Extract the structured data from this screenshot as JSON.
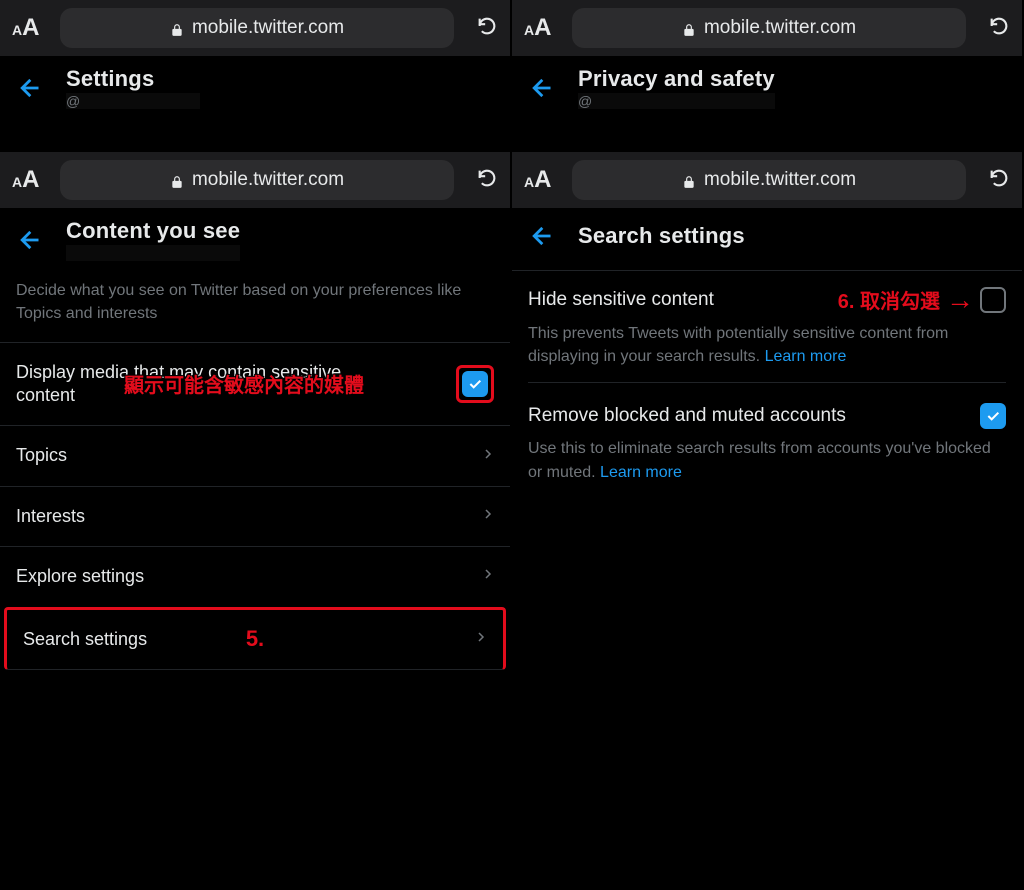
{
  "addrbar_url": "mobile.twitter.com",
  "aa_small": "A",
  "aa_big": "A",
  "panels": {
    "tl": {
      "title": "Settings",
      "sub_prefix": "@"
    },
    "tr": {
      "title": "Privacy and safety",
      "sub_prefix": "@"
    },
    "bl": {
      "title": "Content you see",
      "intro": "Decide what you see on Twitter based on your preferences like Topics and interests",
      "sensitive_label": "Display media that may contain sensitive content",
      "rows": [
        "Topics",
        "Interests",
        "Explore settings",
        "Search settings"
      ]
    },
    "br": {
      "title": "Search settings",
      "hide_label": "Hide sensitive content",
      "hide_desc": "This prevents Tweets with potentially sensitive content from displaying in your search results.",
      "remove_label": "Remove blocked and muted accounts",
      "remove_desc": "Use this to eliminate search results from accounts you've blocked or muted.",
      "learn_more": "Learn more"
    }
  },
  "annotations": {
    "sensitive_zh": "顯示可能含敏感內容的媒體",
    "step5": "5.",
    "step6": "6. 取消勾選",
    "arrow": "→"
  }
}
